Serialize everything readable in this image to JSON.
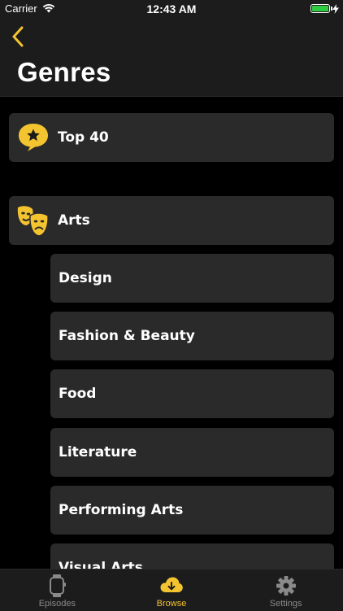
{
  "status_bar": {
    "carrier": "Carrier",
    "time": "12:43 AM",
    "battery_color": "#2ecc40"
  },
  "nav": {
    "back_icon": "chevron-left-icon",
    "title": "Genres",
    "accent_color": "#f4c430"
  },
  "genres": {
    "top": {
      "label": "Top 40",
      "icon": "star-speech-bubble-icon"
    },
    "arts": {
      "label": "Arts",
      "icon": "theater-masks-icon"
    },
    "arts_subgenres": [
      {
        "label": "Design"
      },
      {
        "label": "Fashion & Beauty"
      },
      {
        "label": "Food"
      },
      {
        "label": "Literature"
      },
      {
        "label": "Performing Arts"
      },
      {
        "label": "Visual Arts"
      }
    ]
  },
  "tab_bar": {
    "tabs": [
      {
        "label": "Episodes",
        "icon": "watch-icon",
        "active": false
      },
      {
        "label": "Browse",
        "icon": "cloud-download-icon",
        "active": true
      },
      {
        "label": "Settings",
        "icon": "gear-icon",
        "active": false
      }
    ]
  }
}
